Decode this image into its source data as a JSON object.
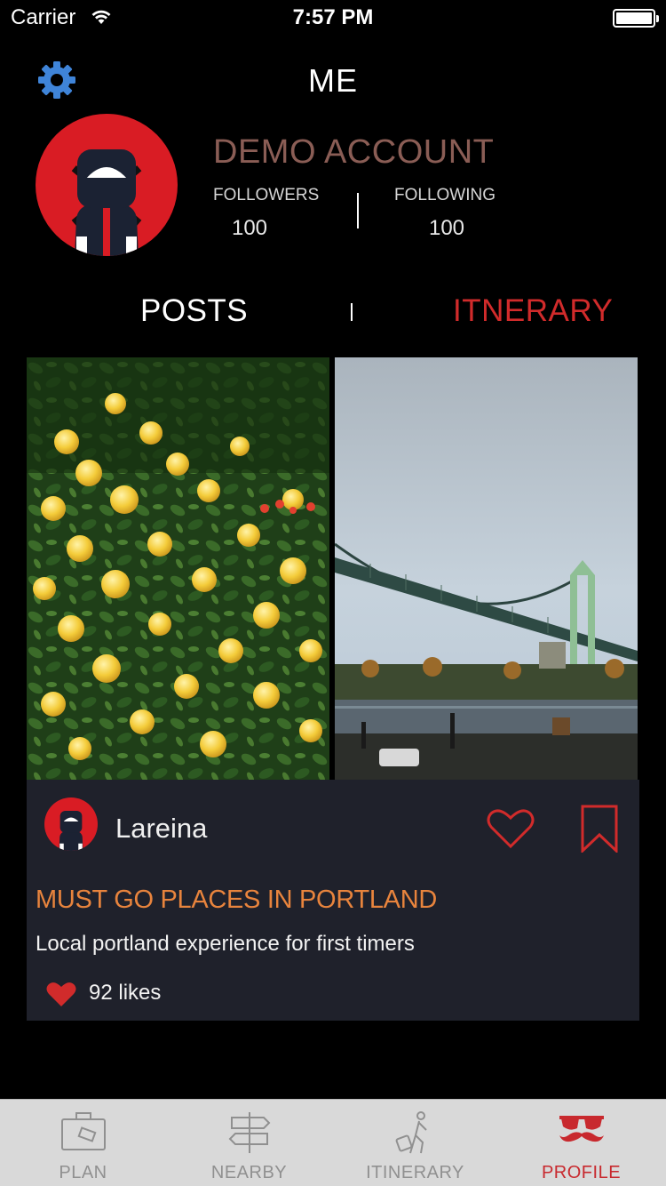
{
  "status_bar": {
    "carrier": "Carrier",
    "time": "7:57 PM"
  },
  "header": {
    "title": "ME"
  },
  "profile": {
    "name": "DEMO ACCOUNT",
    "followers_label": "FOLLOWERS",
    "followers_count": "100",
    "following_label": "FOLLOWING",
    "following_count": "100"
  },
  "tabs": {
    "posts": "POSTS",
    "itinerary": "ITNERARY",
    "active": "itinerary"
  },
  "post": {
    "author": "Lareina",
    "title": "MUST GO PLACES IN PORTLAND",
    "description": "Local portland experience for first timers",
    "likes": "92 likes",
    "photos": [
      "yellow-roses-photo",
      "bridge-photo"
    ]
  },
  "tabbar": {
    "items": [
      {
        "label": "PLAN",
        "icon": "suitcase-icon"
      },
      {
        "label": "NEARBY",
        "icon": "signpost-icon"
      },
      {
        "label": "ITINERARY",
        "icon": "traveler-icon"
      },
      {
        "label": "PROFILE",
        "icon": "mustache-glasses-icon"
      }
    ],
    "active_index": 3
  },
  "colors": {
    "accent_red": "#d12b2b",
    "name_brown": "#8a5d55",
    "post_title_orange": "#e8843d",
    "card_bg": "#1f212b",
    "gear_blue": "#3f84d8"
  }
}
